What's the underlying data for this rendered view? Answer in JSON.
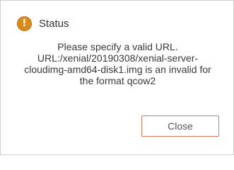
{
  "dialog": {
    "title": "Status",
    "icon": "warning-icon",
    "icon_glyph": "!",
    "icon_color": "#d98a1c",
    "message_lines": [
      "Please specify a valid URL.",
      "URL:/xenial/20190308/xenial-server-",
      "cloudimg-amd64-disk1.img is an invalid for",
      "the format qcow2"
    ],
    "close_label": "Close",
    "button_border_color": "#d9785c"
  }
}
